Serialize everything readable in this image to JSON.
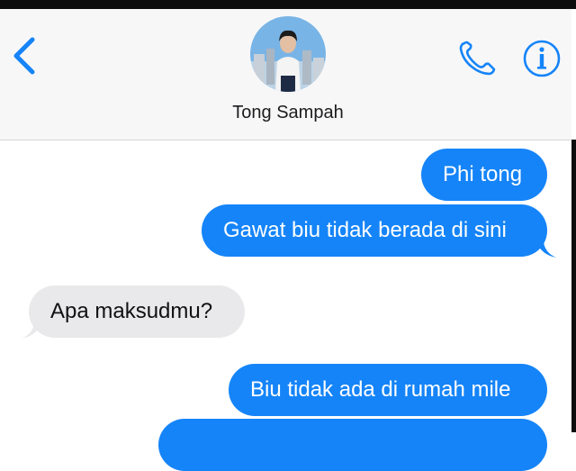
{
  "header": {
    "contact_name": "Tong Sampah"
  },
  "icons": {
    "back": "chevron-left-icon",
    "call": "phone-icon",
    "info": "info-icon"
  },
  "colors": {
    "accent": "#1584f8",
    "incoming_bubble": "#e9e9eb",
    "header_bg": "#f7f7f8"
  },
  "messages": [
    {
      "direction": "outgoing",
      "text": "Phi tong"
    },
    {
      "direction": "outgoing",
      "text": "Gawat biu tidak berada di sini"
    },
    {
      "direction": "incoming",
      "text": "Apa maksudmu?"
    },
    {
      "direction": "outgoing",
      "text": "Biu tidak ada di rumah mile"
    },
    {
      "direction": "outgoing",
      "text": ""
    }
  ]
}
